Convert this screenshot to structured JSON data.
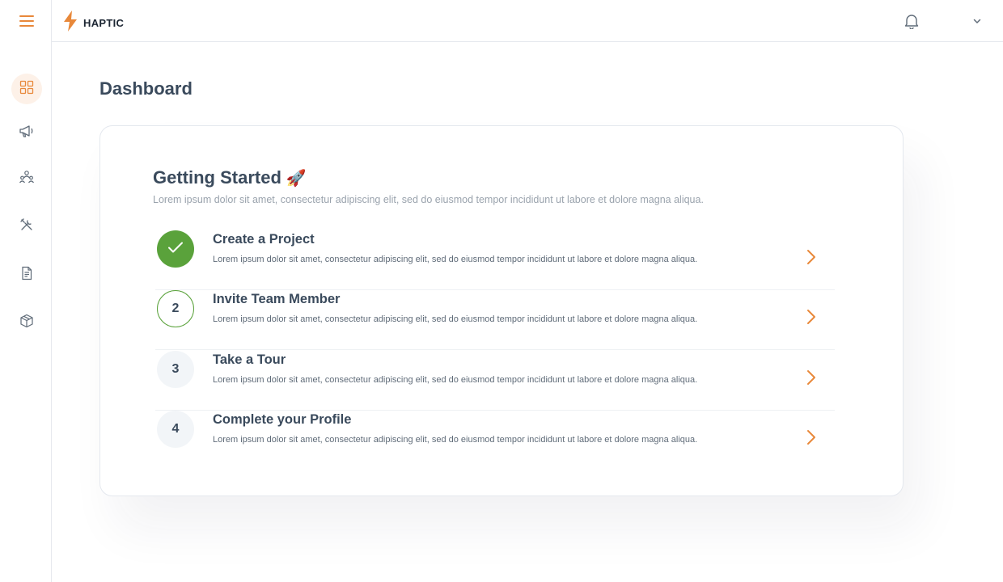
{
  "app": {
    "brand": "HAPTIC"
  },
  "colors": {
    "accent": "#e8883a",
    "success": "#5aa23b",
    "text": "#3a4a5c",
    "muted": "#9aa3ad"
  },
  "sidebar": {
    "items": [
      {
        "icon": "dashboard-grid-icon",
        "active": true
      },
      {
        "icon": "megaphone-icon",
        "active": false
      },
      {
        "icon": "team-icon",
        "active": false
      },
      {
        "icon": "tools-icon",
        "active": false
      },
      {
        "icon": "document-icon",
        "active": false
      },
      {
        "icon": "package-box-icon",
        "active": false
      }
    ]
  },
  "page": {
    "title": "Dashboard"
  },
  "getting_started": {
    "title": "Getting Started",
    "emoji": "🚀",
    "subtitle": "Lorem ipsum dolor sit amet, consectetur adipiscing elit, sed do eiusmod tempor incididunt ut labore et dolore magna aliqua.",
    "steps": [
      {
        "number": "",
        "status": "done",
        "title": "Create a Project",
        "description": "Lorem ipsum dolor sit amet, consectetur adipiscing elit, sed do eiusmod tempor incididunt ut labore et dolore magna aliqua."
      },
      {
        "number": "2",
        "status": "current",
        "title": "Invite Team Member",
        "description": "Lorem ipsum dolor sit amet, consectetur adipiscing elit, sed do eiusmod tempor incididunt ut labore et dolore magna aliqua."
      },
      {
        "number": "3",
        "status": "pending",
        "title": "Take a Tour",
        "description": "Lorem ipsum dolor sit amet, consectetur adipiscing elit, sed do eiusmod tempor incididunt ut labore et dolore magna aliqua."
      },
      {
        "number": "4",
        "status": "pending",
        "title": "Complete your Profile",
        "description": "Lorem ipsum dolor sit amet, consectetur adipiscing elit, sed do eiusmod tempor incididunt ut labore et dolore magna aliqua."
      }
    ]
  }
}
